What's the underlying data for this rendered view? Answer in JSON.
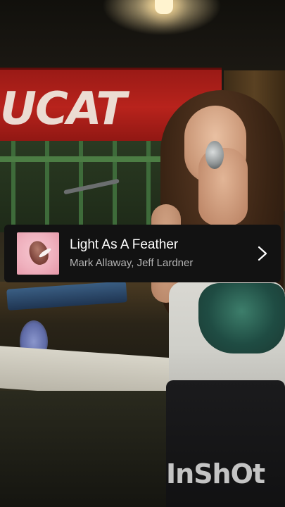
{
  "video": {
    "banner_text": "UCAT",
    "watermark": "InShOt"
  },
  "track": {
    "title": "Light As A Feather",
    "artists": "Mark Allaway, Jeff Lardner",
    "open_icon": "chevron-right-icon",
    "album_art_icon": "album-cover"
  },
  "colors": {
    "card_background": "#121212",
    "title_color": "#ffffff",
    "artists_color": "#b3b3b3"
  }
}
